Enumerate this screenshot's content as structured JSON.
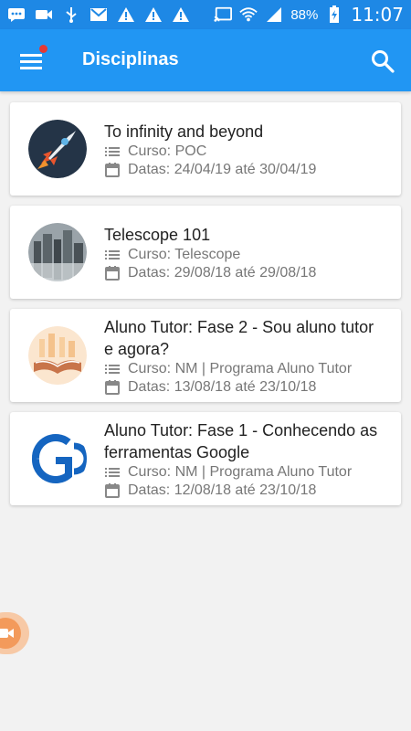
{
  "status_bar": {
    "battery": "88%",
    "time": "11:07"
  },
  "app_bar": {
    "title": "Disciplinas",
    "accent_color": "#2196f3",
    "badge_color": "#e53935"
  },
  "courses": [
    {
      "title": "To infinity and beyond",
      "curso": "Curso: POC",
      "datas": "Datas: 24/04/19 até 30/04/19",
      "thumb": "rocket"
    },
    {
      "title": "Telescope 101",
      "curso": "Curso: Telescope",
      "datas": "Datas: 29/08/18 até 29/08/18",
      "thumb": "city"
    },
    {
      "title": "Aluno Tutor: Fase 2 - Sou aluno tutor e agora?",
      "curso": "Curso: NM | Programa Aluno Tutor",
      "datas": "Datas: 13/08/18 até 23/10/18",
      "thumb": "book"
    },
    {
      "title": "Aluno Tutor: Fase 1 - Conhecendo as ferramentas Google",
      "curso": "Curso: NM | Programa Aluno Tutor",
      "datas": "Datas: 12/08/18 até 23/10/18",
      "thumb": "google"
    }
  ],
  "icons": {
    "menu": "hamburger-icon",
    "search": "search-icon",
    "list": "list-icon",
    "calendar": "calendar-icon",
    "fab": "video-camera-icon"
  }
}
